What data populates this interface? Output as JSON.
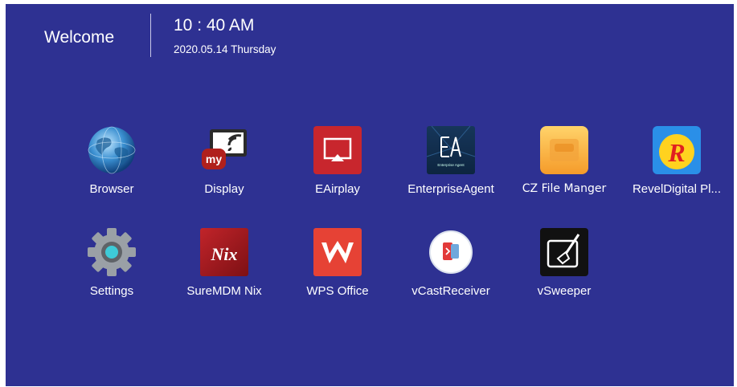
{
  "header": {
    "welcome": "Welcome",
    "time": "10 : 40 AM",
    "date": "2020.05.14 Thursday"
  },
  "apps": [
    {
      "label": "Browser",
      "icon": "browser-globe-icon"
    },
    {
      "label": "Display",
      "icon": "mydisplay-cast-icon"
    },
    {
      "label": "EAirplay",
      "icon": "eairplay-icon"
    },
    {
      "label": "EnterpriseAgent",
      "icon": "enterprise-agent-icon",
      "icon_caption": "Enterprise Agent"
    },
    {
      "label": "CZ File Manger",
      "icon": "cz-file-manager-icon"
    },
    {
      "label": "RevelDigital Pl...",
      "icon": "reveldigital-icon"
    },
    {
      "label": "Settings",
      "icon": "gear-icon"
    },
    {
      "label": "SureMDM Nix",
      "icon": "suremdm-nix-icon",
      "icon_caption": "Nix"
    },
    {
      "label": "WPS Office",
      "icon": "wps-office-icon"
    },
    {
      "label": "vCastReceiver",
      "icon": "vcast-receiver-icon"
    },
    {
      "label": "vSweeper",
      "icon": "vsweeper-icon"
    }
  ],
  "colors": {
    "background": "#2e3192",
    "text": "#ffffff"
  }
}
